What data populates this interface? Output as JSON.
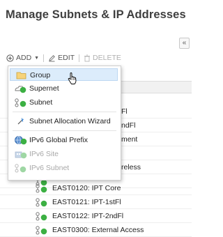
{
  "page": {
    "title": "Manage Subnets & IP Addresses"
  },
  "toolbar": {
    "add_label": "ADD",
    "edit_label": "EDIT",
    "delete_label": "DELETE"
  },
  "menu": {
    "items": [
      {
        "label": "Group",
        "icon": "folder-icon",
        "enabled": true
      },
      {
        "label": "Supernet",
        "icon": "supernet-icon",
        "enabled": true
      },
      {
        "label": "Subnet",
        "icon": "subnet-icon",
        "enabled": true
      },
      {
        "label": "Subnet Allocation Wizard",
        "icon": "wizard-icon",
        "enabled": true
      },
      {
        "label": "IPv6 Global Prefix",
        "icon": "globe-icon",
        "enabled": true
      },
      {
        "label": "IPv6 Site",
        "icon": "site-icon",
        "enabled": false
      },
      {
        "label": "IPv6 Subnet",
        "icon": "subnet-icon",
        "enabled": false
      }
    ]
  },
  "tree": {
    "partial_labels": [
      "Fl",
      "ndFl",
      "ment",
      "reless"
    ],
    "rows": [
      {
        "label": "EAST0120: IPT Core",
        "status": "up"
      },
      {
        "label": "EAST0121: IPT-1stFl",
        "status": "up"
      },
      {
        "label": "EAST0122: IPT-2ndFl",
        "status": "up"
      },
      {
        "label": "EAST0300: External Access",
        "status": "up"
      }
    ]
  },
  "colors": {
    "status_up": "#3cb043",
    "highlight": "#dcecfb",
    "link_blue": "#1a5fa8"
  }
}
